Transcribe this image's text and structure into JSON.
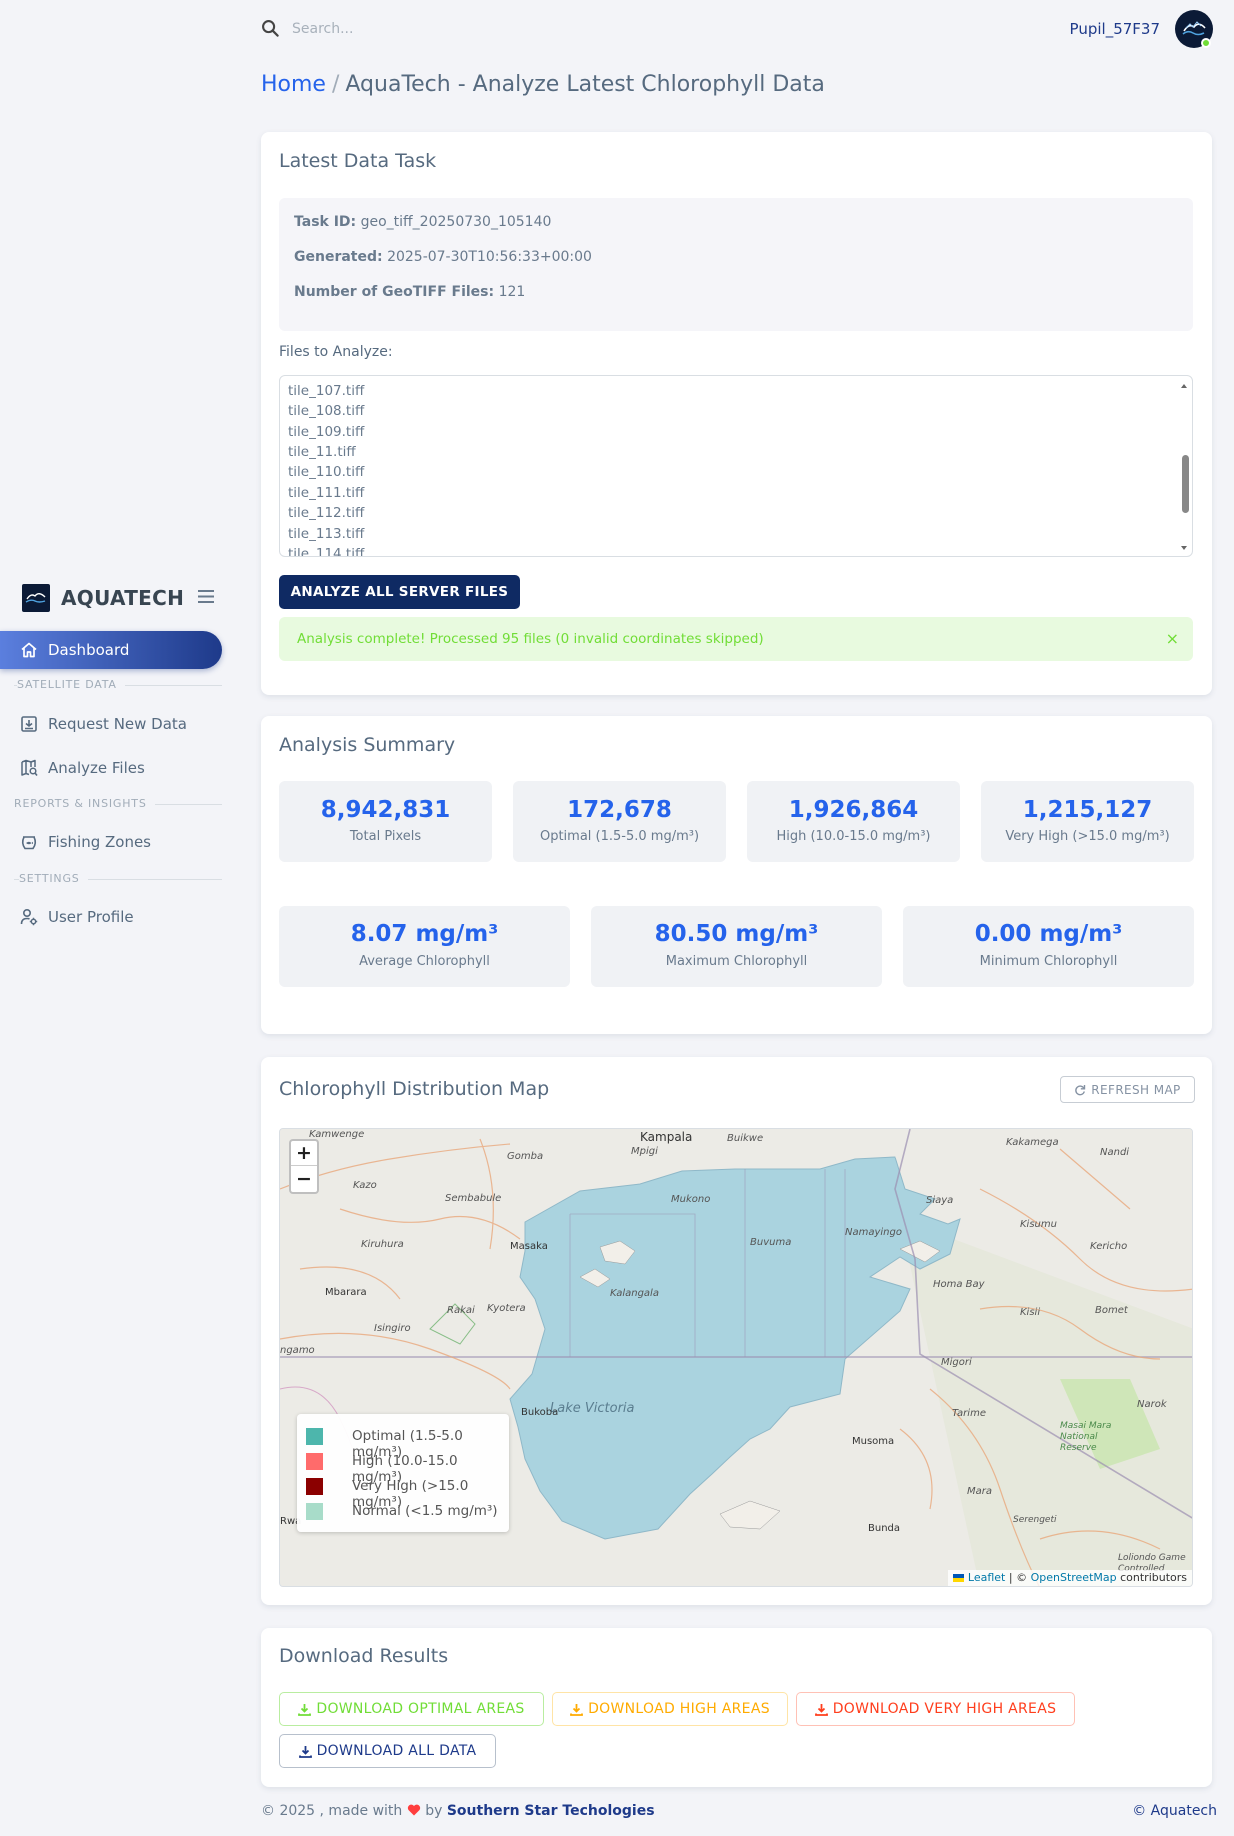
{
  "header": {
    "search_placeholder": "Search...",
    "username": "Pupil_57F37"
  },
  "breadcrumb": {
    "home": "Home",
    "separator": "/",
    "current": "AquaTech - Analyze Latest Chlorophyll Data"
  },
  "sidebar": {
    "brand": "AQUATECH",
    "items": [
      {
        "label": "Dashboard",
        "icon": "home-icon",
        "active": true
      },
      {
        "header": "SATELLITE DATA"
      },
      {
        "label": "Request New Data",
        "icon": "download-box-icon"
      },
      {
        "label": "Analyze Files",
        "icon": "map-search-icon"
      },
      {
        "header": "REPORTS & INSIGHTS"
      },
      {
        "label": "Fishing Zones",
        "icon": "fish-bowl-icon"
      },
      {
        "header": "SETTINGS"
      },
      {
        "label": "User Profile",
        "icon": "user-gear-icon"
      }
    ]
  },
  "task": {
    "title": "Latest Data Task",
    "id_label": "Task ID:",
    "id_value": "geo_tiff_20250730_105140",
    "generated_label": "Generated:",
    "generated_value": "2025-07-30T10:56:33+00:00",
    "count_label": "Number of GeoTIFF Files:",
    "count_value": "121",
    "files_label": "Files to Analyze:",
    "files": [
      "tile_107.tiff",
      "tile_108.tiff",
      "tile_109.tiff",
      "tile_11.tiff",
      "tile_110.tiff",
      "tile_111.tiff",
      "tile_112.tiff",
      "tile_113.tiff",
      "tile_114.tiff"
    ],
    "analyze_button": "ANALYZE ALL SERVER FILES",
    "alert": "Analysis complete! Processed 95 files (0 invalid coordinates skipped)",
    "alert_close": "×"
  },
  "summary": {
    "title": "Analysis Summary",
    "stats": [
      {
        "value": "8,942,831",
        "label": "Total Pixels"
      },
      {
        "value": "172,678",
        "label": "Optimal (1.5-5.0 mg/m³)"
      },
      {
        "value": "1,926,864",
        "label": "High (10.0-15.0 mg/m³)"
      },
      {
        "value": "1,215,127",
        "label": "Very High (>15.0 mg/m³)"
      }
    ],
    "chlorophyll": [
      {
        "value": "8.07 mg/m³",
        "label": "Average Chlorophyll"
      },
      {
        "value": "80.50 mg/m³",
        "label": "Maximum Chlorophyll"
      },
      {
        "value": "0.00 mg/m³",
        "label": "Minimum Chlorophyll"
      }
    ]
  },
  "map": {
    "title": "Chlorophyll Distribution Map",
    "refresh_button": "REFRESH MAP",
    "zoom_in": "+",
    "zoom_out": "−",
    "legend": [
      {
        "label": "Optimal (1.5-5.0 mg/m³)",
        "color": "#4db6ac"
      },
      {
        "label": "High (10.0-15.0 mg/m³)",
        "color": "#ff6b6b"
      },
      {
        "label": "Very High (>15.0 mg/m³)",
        "color": "#8b0000"
      },
      {
        "label": "Normal (<1.5 mg/m³)",
        "color": "#a8dcc9"
      }
    ],
    "attribution_leaflet": "Leaflet",
    "attribution_sep": " | © ",
    "attribution_osm": "OpenStreetMap",
    "attribution_tail": " contributors",
    "places": {
      "kampala": "Kampala",
      "lake": "Lake Victoria",
      "kisumu": "Kisumu",
      "masaka": "Masaka",
      "bukoba": "Bukoba",
      "musoma": "Musoma",
      "mbarara": "Mbarara",
      "kakamega": "Kakamega",
      "kericho": "Kericho",
      "homabay": "Homa Bay",
      "migori": "Migori",
      "bunda": "Bunda",
      "mpigi": "Mpigi",
      "mukono": "Mukono",
      "buvuma": "Buvuma",
      "namayingo": "Namayingo",
      "siaya": "Siaya",
      "kalangala": "Kalangala",
      "gomba": "Gomba",
      "kazo": "Kazo",
      "sembabule": "Sembabule",
      "kiruhura": "Kiruhura",
      "rakai": "Rakai",
      "kyotera": "Kyotera",
      "isingiro": "Isingiro",
      "tarime": "Tarime",
      "bomet": "Bomet",
      "narok": "Narok",
      "kisii": "Kisii",
      "mara": "Mara",
      "serengeti": "Serengeti",
      "nandi": "Nandi",
      "buikwe": "Buikwe",
      "kamwenge": "Kamwenge",
      "ngamo": "ngamo",
      "rwa": "Rwa",
      "masai_mara": "Masai Mara National Reserve",
      "loliondo": "Loliondo Game Controlled"
    }
  },
  "downloads": {
    "title": "Download Results",
    "optimal": "DOWNLOAD OPTIMAL AREAS",
    "high": "DOWNLOAD HIGH AREAS",
    "very_high": "DOWNLOAD VERY HIGH AREAS",
    "all": "DOWNLOAD ALL DATA",
    "colors": {
      "optimal": "#71dd37",
      "high": "#ffab00",
      "very_high": "#ff3e1d",
      "all": "#1e3a8a"
    }
  },
  "footer": {
    "prefix": "© 2025 , made with",
    "by": "by",
    "company": "Southern Star Techologies",
    "right": "© Aquatech"
  }
}
